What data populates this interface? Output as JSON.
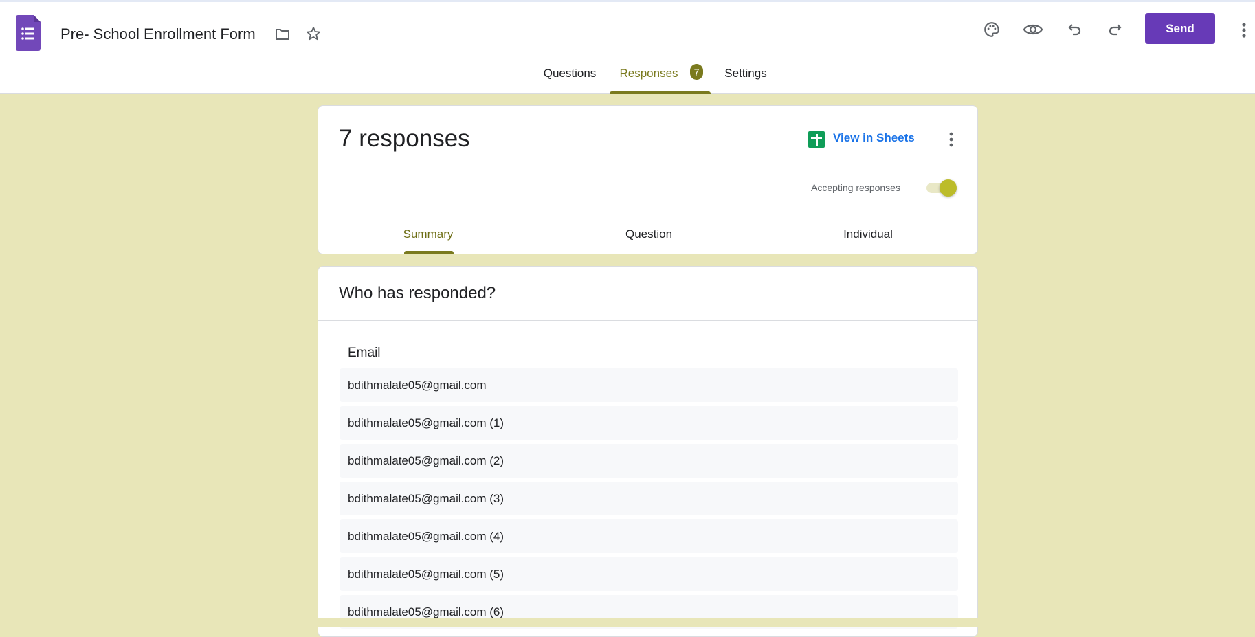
{
  "header": {
    "title": "Pre- School Enrollment Form",
    "send_label": "Send",
    "icons": [
      "forms-logo-icon",
      "folder-icon",
      "star-icon",
      "palette-icon",
      "eye-icon",
      "undo-icon",
      "redo-icon",
      "more-vert-icon"
    ]
  },
  "tabs": [
    {
      "label": "Questions"
    },
    {
      "label": "Responses",
      "badge": "7"
    },
    {
      "label": "Settings"
    }
  ],
  "summary_card": {
    "count": "7 responses",
    "view_in_sheets": "View in Sheets",
    "accepting_label": "Accepting responses",
    "accepting": true,
    "subtabs": [
      {
        "label": "Summary"
      },
      {
        "label": "Question"
      },
      {
        "label": "Individual"
      }
    ]
  },
  "responders": {
    "title": "Who has responded?",
    "column": "Email",
    "emails": [
      "bdithmalate05@gmail.com",
      "bdithmalate05@gmail.com (1)",
      "bdithmalate05@gmail.com (2)",
      "bdithmalate05@gmail.com (3)",
      "bdithmalate05@gmail.com (4)",
      "bdithmalate05@gmail.com (5)",
      "bdithmalate05@gmail.com (6)"
    ]
  },
  "colors": {
    "accent": "#7a7a1e",
    "background": "#e8e6b8",
    "send": "#673ab7",
    "link": "#1a73e8"
  }
}
